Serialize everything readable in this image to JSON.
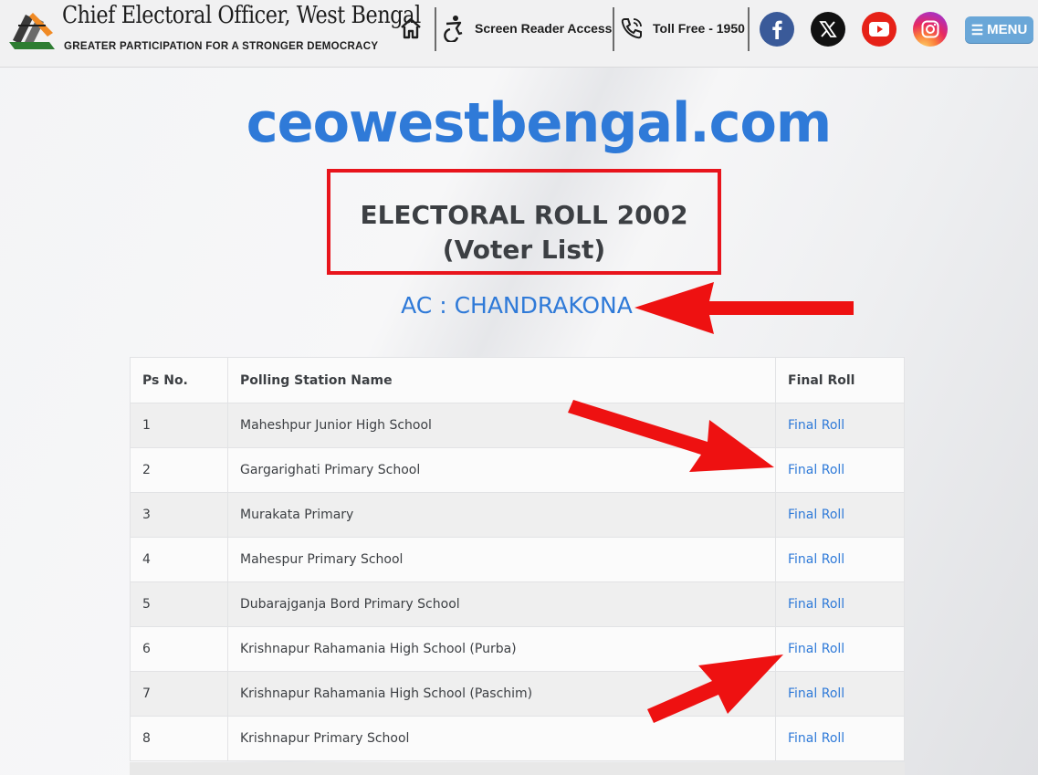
{
  "header": {
    "title": "Chief Electoral Officer, West Bengal",
    "tagline": "GREATER PARTICIPATION FOR A STRONGER DEMOCRACY",
    "screen_reader_label": "Screen Reader Access",
    "toll_free_label": "Toll Free - 1950",
    "menu_label": "MENU",
    "icons": [
      "home-icon",
      "accessibility-icon",
      "phone-icon",
      "facebook-icon",
      "x-icon",
      "youtube-icon",
      "instagram-icon",
      "hamburger-icon"
    ]
  },
  "main": {
    "site_name": "ceowestbengal.com",
    "roll_title_line1": "ELECTORAL ROLL 2002",
    "roll_title_line2": "(Voter List)",
    "ac_name": "AC : CHANDRAKONA"
  },
  "table": {
    "headers": [
      "Ps No.",
      "Polling Station Name",
      "Final Roll"
    ],
    "rows": [
      {
        "ps": "1",
        "name": "Maheshpur Junior High School",
        "link": "Final Roll"
      },
      {
        "ps": "2",
        "name": "Gargarighati Primary School",
        "link": "Final Roll"
      },
      {
        "ps": "3",
        "name": "Murakata Primary",
        "link": "Final Roll"
      },
      {
        "ps": "4",
        "name": "Mahespur Primary School",
        "link": "Final Roll"
      },
      {
        "ps": "5",
        "name": "Dubarajganja Bord Primary School",
        "link": "Final Roll"
      },
      {
        "ps": "6",
        "name": "Krishnapur Rahamania High School (Purba)",
        "link": "Final Roll"
      },
      {
        "ps": "7",
        "name": "Krishnapur Rahamania High School (Paschim)",
        "link": "Final Roll"
      },
      {
        "ps": "8",
        "name": "Krishnapur Primary School",
        "link": "Final Roll"
      }
    ]
  },
  "colors": {
    "accent_blue": "#2f7ad8",
    "highlight_red": "#e8141c",
    "menu_blue": "#6aa7d8"
  }
}
